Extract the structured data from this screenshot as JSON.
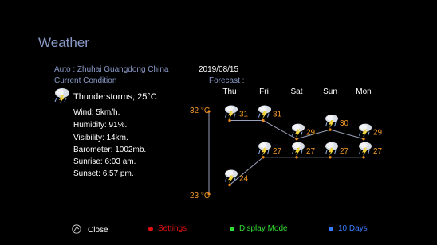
{
  "header": {
    "title": "Weather"
  },
  "location": {
    "label": "Auto : Zhuhai   Guangdong  China",
    "date": "2019/08/15"
  },
  "current": {
    "section_label": "Current Condition :",
    "condition": "Thunderstorms, 25°C",
    "icon": "thunderstorm-icon",
    "details": [
      "Wind: 5km/h.",
      "Humidity: 91%.",
      "Visibility: 14km.",
      "Barometer: 1002mb.",
      "Sunrise: 6:03 am.",
      "Sunset: 6:57 pm."
    ]
  },
  "forecast": {
    "section_label": "Forecast :",
    "max_label": "32 °C",
    "min_label": "23 °C",
    "days": [
      {
        "day": "Thu",
        "high": "31",
        "low": "24"
      },
      {
        "day": "Fri",
        "high": "31",
        "low": "27"
      },
      {
        "day": "Sat",
        "high": "29",
        "low": "27"
      },
      {
        "day": "Sun",
        "high": "30",
        "low": "27"
      },
      {
        "day": "Mon",
        "high": "29",
        "low": "27"
      }
    ],
    "colors": {
      "line": "#9aa0b8",
      "point": "#f08a1a",
      "text": "#f39a2a"
    }
  },
  "footer": {
    "close": {
      "label": "Close",
      "icon": "close-icon"
    },
    "settings": {
      "label": "Settings",
      "color": "#e01010"
    },
    "display_mode": {
      "label": "Display Mode",
      "color": "#33dd33"
    },
    "ten_days": {
      "label": "10 Days",
      "color": "#3a7bff"
    }
  }
}
